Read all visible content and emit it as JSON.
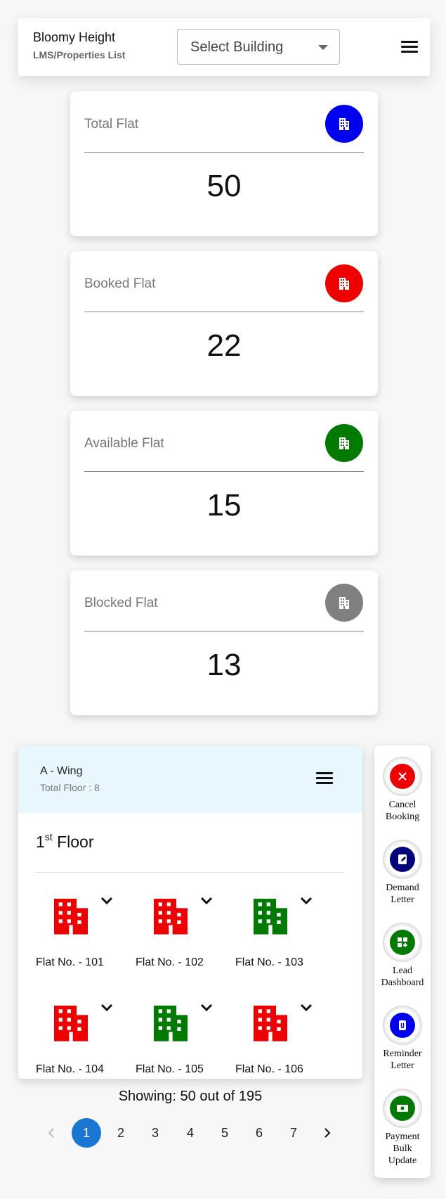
{
  "header": {
    "title": "Bloomy Height",
    "breadcrumb": "LMS/Properties List",
    "select_value": "Select Building"
  },
  "stats": [
    {
      "label": "Total Flat",
      "value": "50",
      "color": "#0000ee"
    },
    {
      "label": "Booked Flat",
      "value": "22",
      "color": "#ee0000"
    },
    {
      "label": "Available Flat",
      "value": "15",
      "color": "#007a00"
    },
    {
      "label": "Blocked Flat",
      "value": "13",
      "color": "#808080"
    }
  ],
  "wing": {
    "name": "A - Wing",
    "total_floor": "Total Floor : 8",
    "floor_number": "1",
    "floor_suffix": "st",
    "floor_word": "Floor",
    "flats": [
      {
        "label": "Flat No. - 101",
        "status_color": "#ee0000"
      },
      {
        "label": "Flat No. - 102",
        "status_color": "#ee0000"
      },
      {
        "label": "Flat No. - 103",
        "status_color": "#007a00"
      },
      {
        "label": "Flat No. - 104",
        "status_color": "#ee0000"
      },
      {
        "label": "Flat No. - 105",
        "status_color": "#007a00"
      },
      {
        "label": "Flat No. - 106",
        "status_color": "#ee0000"
      }
    ]
  },
  "pagination": {
    "showing": "Showing: 50 out of 195",
    "pages": [
      "1",
      "2",
      "3",
      "4",
      "5",
      "6",
      "7"
    ],
    "active_page": "1",
    "accent": "#1976d2"
  },
  "actions": [
    {
      "line1": "Cancel",
      "line2": "Booking",
      "line3": "",
      "icon": "close-icon",
      "color": "#ee0000"
    },
    {
      "line1": "Demand",
      "line2": "Letter",
      "line3": "",
      "icon": "edit-document-icon",
      "color": "#00007a"
    },
    {
      "line1": "Lead",
      "line2": "Dashboard",
      "line3": "",
      "icon": "dashboard-icon",
      "color": "#007a00"
    },
    {
      "line1": "Reminder",
      "line2": "Letter",
      "line3": "",
      "icon": "attachment-icon",
      "color": "#0000ee"
    },
    {
      "line1": "Payment",
      "line2": "Bulk",
      "line3": "Update",
      "icon": "payment-icon",
      "color": "#007a00"
    }
  ]
}
